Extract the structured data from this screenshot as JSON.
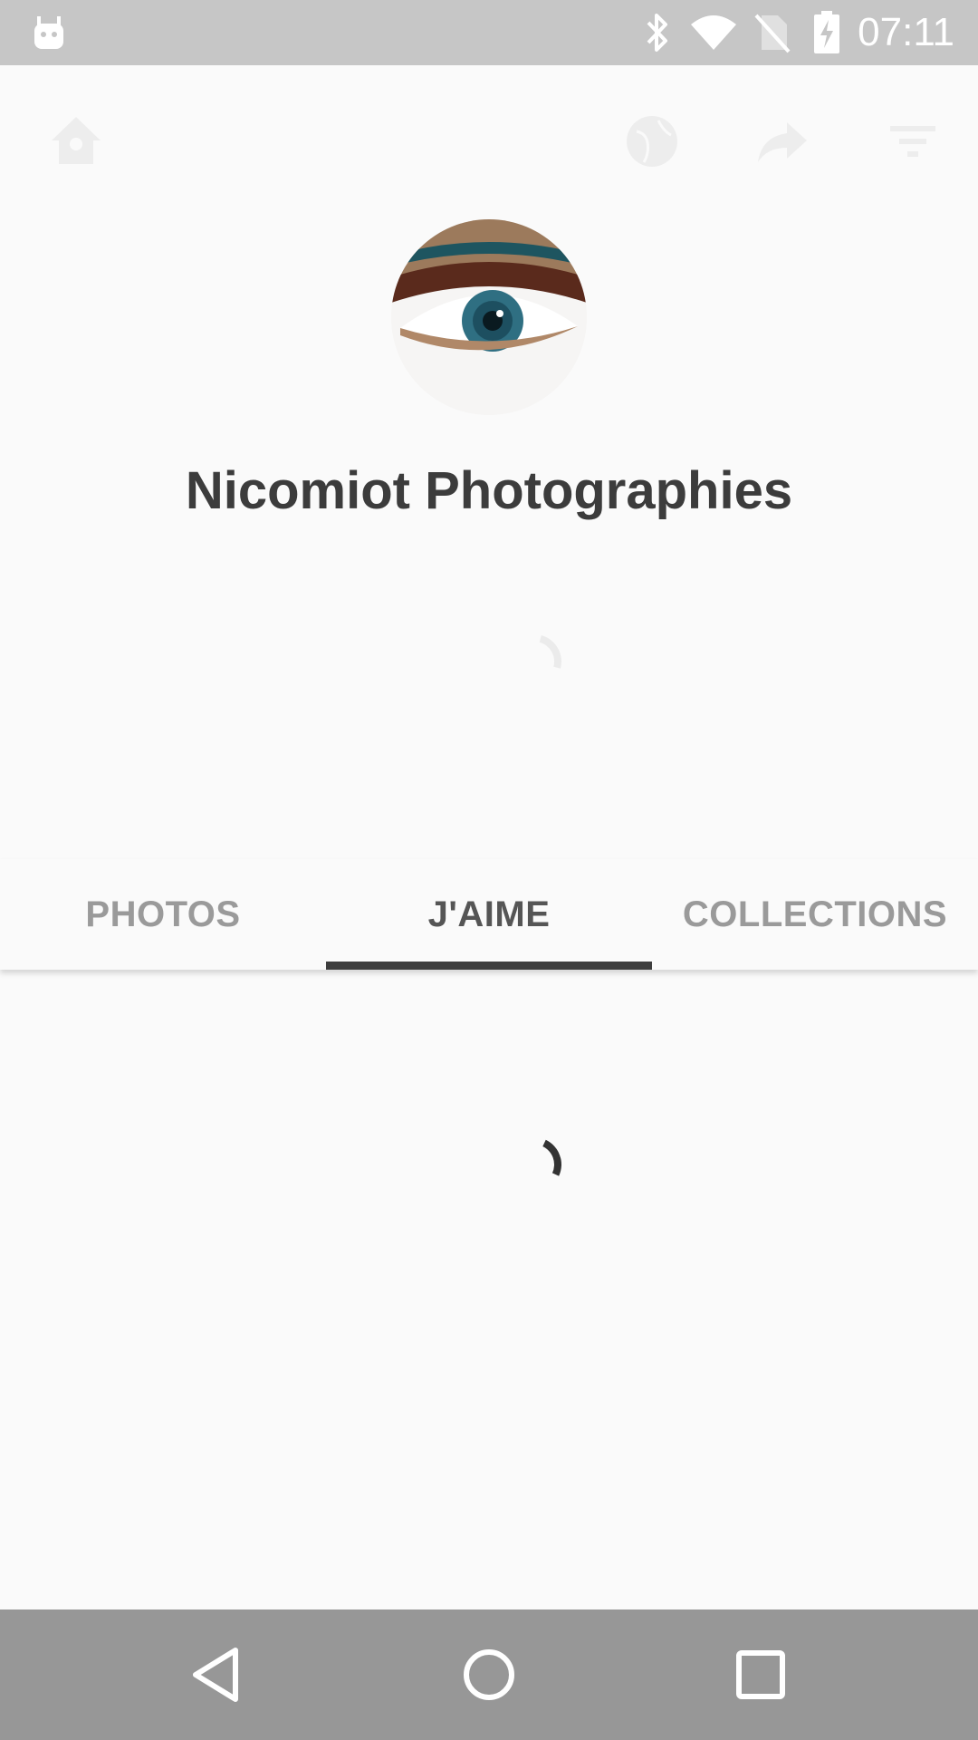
{
  "status_bar": {
    "time": "07:11",
    "icons": [
      "android-notification-icon",
      "bluetooth-icon",
      "wifi-icon",
      "no-sim-icon",
      "battery-charging-icon"
    ]
  },
  "toolbar": {
    "icons": [
      "home-location-icon",
      "globe-icon",
      "share-icon",
      "filter-icon"
    ]
  },
  "profile": {
    "name": "Nicomiot Photographies"
  },
  "tabs": [
    {
      "label": "PHOTOS",
      "active": false
    },
    {
      "label": "J'AIME",
      "active": true
    },
    {
      "label": "COLLECTIONS",
      "active": false
    }
  ],
  "nav_bar": {
    "icons": [
      "back-icon",
      "home-icon",
      "recents-icon"
    ]
  },
  "colors": {
    "status_bar": "#c6c6c6",
    "background": "#fafafa",
    "title_text": "#3c3c3c",
    "tab_inactive": "#9a9a9a",
    "tab_active": "#555555",
    "tab_indicator": "#3d3d3d",
    "nav_bar": "#979797"
  }
}
